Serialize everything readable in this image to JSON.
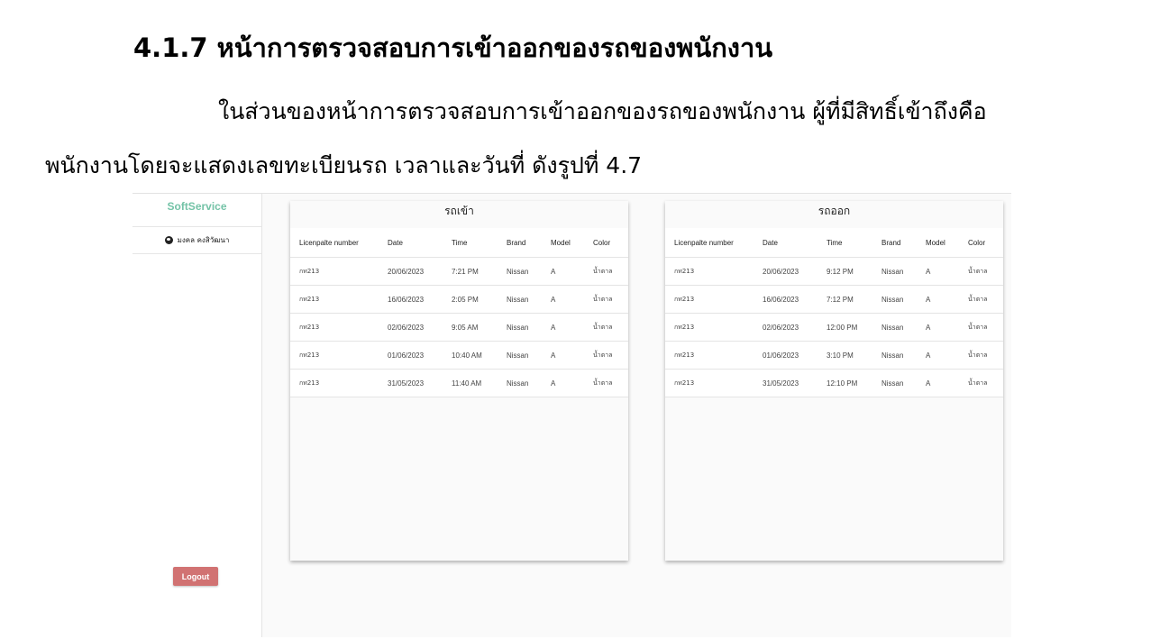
{
  "document": {
    "heading": "4.1.7 หน้าการตรวจสอบการเข้าออกของรถของพนักงาน",
    "paragraph_line1": "ในส่วนของหน้าการตรวจสอบการเข้าออกของรถของพนักงาน ผู้ที่มีสิทธิ์เข้าถึงคือ",
    "paragraph_line2": "พนักงานโดยจะแสดงเลขทะเบียนรถ เวลาและวันที่ ดังรูปที่ 4.7"
  },
  "sidebar": {
    "brand": "SoftService",
    "user_name": "มงคล คงสิวัฒนา",
    "user_icon": "user-circle-icon",
    "logout_label": "Logout"
  },
  "columns": [
    "Licenpalte number",
    "Date",
    "Time",
    "Brand",
    "Model",
    "Color"
  ],
  "panel_in": {
    "title": "รถเข้า",
    "rows": [
      [
        "กท213",
        "20/06/2023",
        "7:21 PM",
        "Nissan",
        "A",
        "น้ำตาล"
      ],
      [
        "กท213",
        "16/06/2023",
        "2:05 PM",
        "Nissan",
        "A",
        "น้ำตาล"
      ],
      [
        "กท213",
        "02/06/2023",
        "9:05 AM",
        "Nissan",
        "A",
        "น้ำตาล"
      ],
      [
        "กท213",
        "01/06/2023",
        "10:40 AM",
        "Nissan",
        "A",
        "น้ำตาล"
      ],
      [
        "กท213",
        "31/05/2023",
        "11:40 AM",
        "Nissan",
        "A",
        "น้ำตาล"
      ]
    ]
  },
  "panel_out": {
    "title": "รถออก",
    "rows": [
      [
        "กท213",
        "20/06/2023",
        "9:12 PM",
        "Nissan",
        "A",
        "น้ำตาล"
      ],
      [
        "กท213",
        "16/06/2023",
        "7:12 PM",
        "Nissan",
        "A",
        "น้ำตาล"
      ],
      [
        "กท213",
        "02/06/2023",
        "12:00 PM",
        "Nissan",
        "A",
        "น้ำตาล"
      ],
      [
        "กท213",
        "01/06/2023",
        "3:10 PM",
        "Nissan",
        "A",
        "น้ำตาล"
      ],
      [
        "กท213",
        "31/05/2023",
        "12:10 PM",
        "Nissan",
        "A",
        "น้ำตาล"
      ]
    ]
  },
  "colors": {
    "brand": "#74c3a7",
    "logout": "#d17272"
  }
}
